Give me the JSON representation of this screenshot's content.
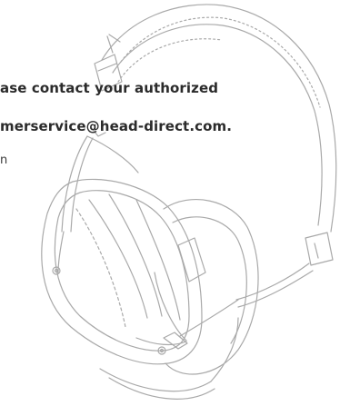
{
  "document": {
    "lines": [
      "ase contact your authorized",
      "merservice@head-direct.com.",
      "n"
    ]
  },
  "illustration": {
    "name": "headphones-sketch",
    "stroke_color": "#a9a9a9",
    "fill_color": "#ffffff"
  }
}
